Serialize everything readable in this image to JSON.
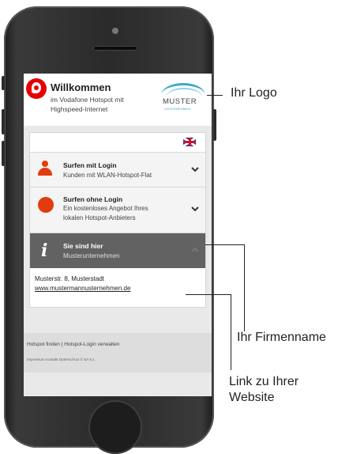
{
  "header": {
    "title": "Willkommen",
    "subtitle_line1": "im Vodafone Hotspot mit",
    "subtitle_line2": "Highspeed-Internet",
    "logo_name": "MUSTER",
    "logo_sub": "UNTERNEHMEN"
  },
  "language": {
    "icon": "uk-flag-icon"
  },
  "items": [
    {
      "title": "Surfen mit Login",
      "desc1": "Kunden mit WLAN-Hotspot-Flat",
      "desc2": "",
      "icon": "person-icon"
    },
    {
      "title": "Surfen ohne Login",
      "desc1": "Ein kostenloses Angebot Ihres",
      "desc2": "lokalen Hotspot-Anbieters",
      "icon": "globe-icon"
    },
    {
      "title": "Sie sind hier",
      "desc1": "Musterunternehmen",
      "desc2": "",
      "icon": "info-icon"
    }
  ],
  "address": {
    "line1": "Musterstr. 8, Musterstadt",
    "link": "www.mustermannusternehmen.de"
  },
  "footer": {
    "line1": "Hotspot finden  |  Hotspot-Login verwalten",
    "line2": "Impressum  Kontakt  Datenschutz  © BA 6.1"
  },
  "callouts": {
    "logo": "Ihr Logo",
    "company": "Ihr Firmenname",
    "website_line1": "Link zu Ihrer",
    "website_line2": "Website"
  },
  "colors": {
    "vodafone_red": "#e60000",
    "accent_orange": "#e33b10",
    "muster_teal": "#39a9c6"
  }
}
